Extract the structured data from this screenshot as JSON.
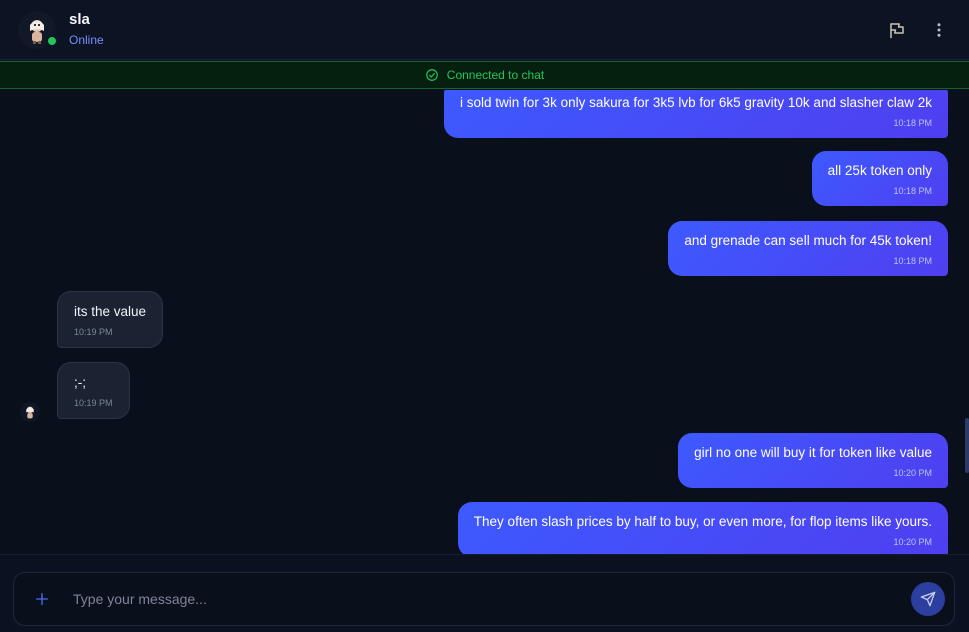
{
  "header": {
    "user_name": "sla",
    "user_status": "Online",
    "flag_icon": "flag-icon",
    "menu_icon": "more-vertical-icon"
  },
  "banner": {
    "text": "Connected to chat",
    "icon": "check-circle-icon"
  },
  "messages": [
    {
      "direction": "out",
      "text": "i sold twin for 3k only sakura for 3k5 lvb for 6k5 gravity 10k and slasher claw 2k",
      "time": "10:18 PM"
    },
    {
      "direction": "out",
      "text": "all 25k token only",
      "time": "10:18 PM"
    },
    {
      "direction": "out",
      "text": "and grenade can sell much for 45k token!",
      "time": "10:18 PM"
    },
    {
      "direction": "in",
      "text": "its the value",
      "time": "10:19 PM"
    },
    {
      "direction": "in",
      "text": ";-;",
      "time": "10:19 PM"
    },
    {
      "direction": "out",
      "text": "girl no one will buy it for token like value",
      "time": "10:20 PM"
    },
    {
      "direction": "out",
      "text": "They often slash prices by half to buy, or even more, for flop items like yours.",
      "time": "10:20 PM"
    }
  ],
  "composer": {
    "placeholder": "Type your message...",
    "value": "",
    "plus_icon": "plus-icon",
    "send_icon": "send-icon"
  },
  "colors": {
    "accent": "#3d5afe",
    "online": "#22c55e",
    "status_text": "#7c8cff"
  }
}
